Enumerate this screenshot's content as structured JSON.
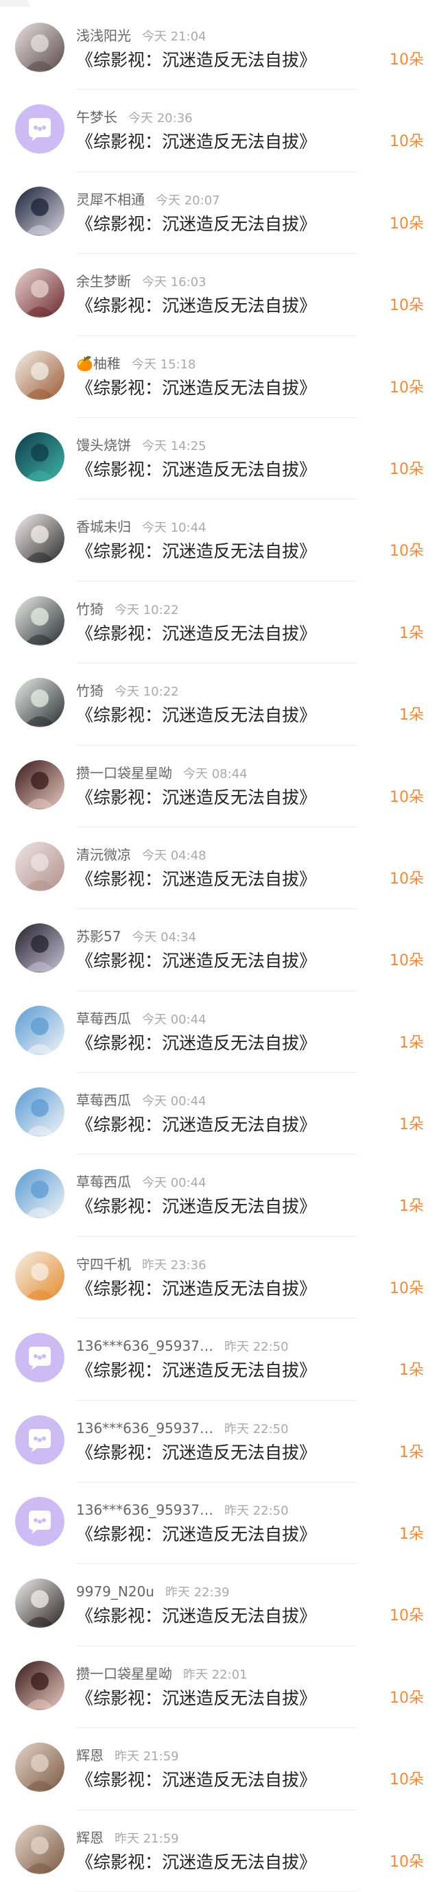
{
  "title": "《综影视：沉迷造反无法自拔》",
  "palette": {
    "gift_color": "#f0883a",
    "name_color": "#666666",
    "time_color": "#aaaaaa"
  },
  "gifts": [
    {
      "name": "浅浅阳光",
      "time": "今天 21:04",
      "amount": "10朵",
      "avatar": "photo",
      "avatar_colors": [
        "#e7dfe0",
        "#5b4a4a"
      ]
    },
    {
      "name": "午梦长",
      "time": "今天 20:36",
      "amount": "10朵",
      "avatar": "chat-bubble",
      "avatar_colors": [
        "#cdbcf3",
        "#ffffff"
      ]
    },
    {
      "name": "灵犀不相通",
      "time": "今天 20:07",
      "amount": "10朵",
      "avatar": "photo",
      "avatar_colors": [
        "#1b2238",
        "#d6d3e0"
      ]
    },
    {
      "name": "余生梦断",
      "time": "今天 16:03",
      "amount": "10朵",
      "avatar": "photo",
      "avatar_colors": [
        "#e9d2cf",
        "#6c2a30"
      ]
    },
    {
      "name": "🍊柚稚",
      "time": "今天 15:18",
      "amount": "10朵",
      "avatar": "photo",
      "avatar_colors": [
        "#f3efe8",
        "#9b5b35"
      ]
    },
    {
      "name": "馒头烧饼",
      "time": "今天 14:25",
      "amount": "10朵",
      "avatar": "photo",
      "avatar_colors": [
        "#0f3b48",
        "#3fb3a7"
      ]
    },
    {
      "name": "香城未归",
      "time": "今天 10:44",
      "amount": "10朵",
      "avatar": "photo",
      "avatar_colors": [
        "#f5eeee",
        "#2b2b2b"
      ]
    },
    {
      "name": "竹猗",
      "time": "今天 10:22",
      "amount": "1朵",
      "avatar": "photo",
      "avatar_colors": [
        "#e7ece6",
        "#2a2f33"
      ]
    },
    {
      "name": "竹猗",
      "time": "今天 10:22",
      "amount": "1朵",
      "avatar": "photo",
      "avatar_colors": [
        "#e7ece6",
        "#2a2f33"
      ]
    },
    {
      "name": "攒一口袋星星呦",
      "time": "今天 08:44",
      "amount": "10朵",
      "avatar": "photo",
      "avatar_colors": [
        "#3a1a1a",
        "#e8c9c0"
      ]
    },
    {
      "name": "清沅微凉",
      "time": "今天 04:48",
      "amount": "10朵",
      "avatar": "photo",
      "avatar_colors": [
        "#ece4e3",
        "#b4918c"
      ]
    },
    {
      "name": "苏影57",
      "time": "今天 04:34",
      "amount": "10朵",
      "avatar": "photo",
      "avatar_colors": [
        "#24212d",
        "#c7c2d6"
      ]
    },
    {
      "name": "草莓西瓜",
      "time": "今天 00:44",
      "amount": "1朵",
      "avatar": "photo",
      "avatar_colors": [
        "#5b9bd3",
        "#f0f3f7"
      ]
    },
    {
      "name": "草莓西瓜",
      "time": "今天 00:44",
      "amount": "1朵",
      "avatar": "photo",
      "avatar_colors": [
        "#5b9bd3",
        "#f0f3f7"
      ]
    },
    {
      "name": "草莓西瓜",
      "time": "今天 00:44",
      "amount": "1朵",
      "avatar": "photo",
      "avatar_colors": [
        "#5b9bd3",
        "#f0f3f7"
      ]
    },
    {
      "name": "守四千机",
      "time": "昨天 23:36",
      "amount": "10朵",
      "avatar": "photo",
      "avatar_colors": [
        "#f5efe6",
        "#e58b2e"
      ]
    },
    {
      "name": "136***636_95937…",
      "time": "昨天 22:50",
      "amount": "1朵",
      "avatar": "chat-bubble",
      "avatar_colors": [
        "#cdbcf3",
        "#ffffff"
      ]
    },
    {
      "name": "136***636_95937…",
      "time": "昨天 22:50",
      "amount": "1朵",
      "avatar": "chat-bubble",
      "avatar_colors": [
        "#cdbcf3",
        "#ffffff"
      ]
    },
    {
      "name": "136***636_95937…",
      "time": "昨天 22:50",
      "amount": "1朵",
      "avatar": "chat-bubble",
      "avatar_colors": [
        "#cdbcf3",
        "#ffffff"
      ]
    },
    {
      "name": "9979_N20u",
      "time": "昨天 22:39",
      "amount": "10朵",
      "avatar": "photo",
      "avatar_colors": [
        "#f0eded",
        "#2c2424"
      ]
    },
    {
      "name": "攒一口袋星星呦",
      "time": "昨天 22:01",
      "amount": "10朵",
      "avatar": "photo",
      "avatar_colors": [
        "#3a1a1a",
        "#e8c9c0"
      ]
    },
    {
      "name": "辉恩",
      "time": "昨天 21:59",
      "amount": "10朵",
      "avatar": "photo",
      "avatar_colors": [
        "#e4d4c8",
        "#7a5a44"
      ]
    },
    {
      "name": "辉恩",
      "time": "昨天 21:59",
      "amount": "10朵",
      "avatar": "photo",
      "avatar_colors": [
        "#e4d4c8",
        "#7a5a44"
      ]
    }
  ]
}
